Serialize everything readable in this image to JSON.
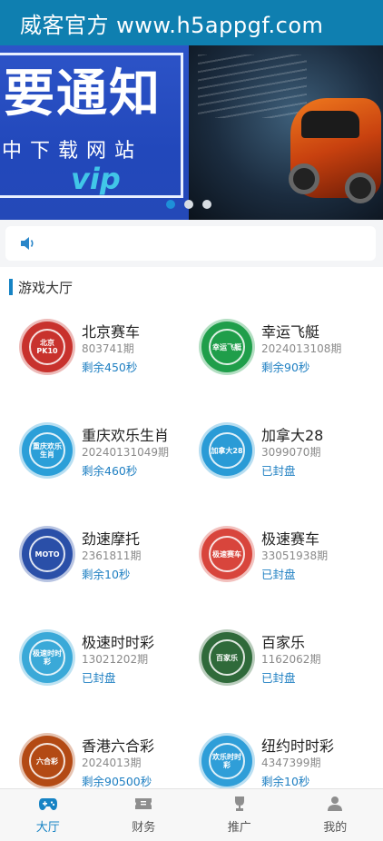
{
  "header": {
    "title": "威客官方 www.h5appgf.com"
  },
  "banner": {
    "headline": "要通知",
    "subline": "中下载网站",
    "badge": "vip",
    "slide_count": 3,
    "active_slide": 0
  },
  "notice": {
    "icon": "speaker-icon",
    "text": ""
  },
  "lobby": {
    "title": "游戏大厅",
    "games": [
      {
        "name": "北京赛车",
        "period": "803741期",
        "status": "剩余450秒",
        "icon": "beijing-pk10-icon",
        "icon_text": "北京PK10",
        "color": "#c8322d"
      },
      {
        "name": "幸运飞艇",
        "period": "2024013108期",
        "status": "剩余90秒",
        "icon": "lucky-airship-icon",
        "icon_text": "幸运飞艇",
        "color": "#1f9e4a"
      },
      {
        "name": "重庆欢乐生肖",
        "period": "20240131049期",
        "status": "剩余460秒",
        "icon": "chongqing-zodiac-icon",
        "icon_text": "重庆欢乐生肖",
        "color": "#2b9fd8"
      },
      {
        "name": "加拿大28",
        "period": "3099070期",
        "status": "已封盘",
        "icon": "canada-28-icon",
        "icon_text": "加拿大28",
        "color": "#2a9bd6"
      },
      {
        "name": "劲速摩托",
        "period": "2361811期",
        "status": "剩余10秒",
        "icon": "speed-moto-icon",
        "icon_text": "MOTO",
        "color": "#2a4fa8"
      },
      {
        "name": "极速赛车",
        "period": "33051938期",
        "status": "已封盘",
        "icon": "speed-racing-icon",
        "icon_text": "极速赛车",
        "color": "#d8453c"
      },
      {
        "name": "极速时时彩",
        "period": "13021202期",
        "status": "已封盘",
        "icon": "speed-ssc-icon",
        "icon_text": "极速时时彩",
        "color": "#3aa9d8"
      },
      {
        "name": "百家乐",
        "period": "1162062期",
        "status": "已封盘",
        "icon": "baccarat-icon",
        "icon_text": "百家乐",
        "color": "#2f6a3a"
      },
      {
        "name": "香港六合彩",
        "period": "2024013期",
        "status": "剩余90500秒",
        "icon": "hk-mark-six-icon",
        "icon_text": "六合彩",
        "color": "#b34a14"
      },
      {
        "name": "纽约时时彩",
        "period": "4347399期",
        "status": "剩余10秒",
        "icon": "newyork-ssc-icon",
        "icon_text": "欢乐时时彩",
        "color": "#2f9ed8"
      }
    ]
  },
  "tabbar": {
    "items": [
      {
        "label": "大厅",
        "icon": "gamepad-icon",
        "active": true
      },
      {
        "label": "财务",
        "icon": "ticket-icon",
        "active": false
      },
      {
        "label": "推广",
        "icon": "trophy-icon",
        "active": false
      },
      {
        "label": "我的",
        "icon": "user-icon",
        "active": false
      }
    ]
  },
  "colors": {
    "primary": "#0f7fb0",
    "accent": "#1683c4",
    "status_blue": "#1e7fc2"
  }
}
